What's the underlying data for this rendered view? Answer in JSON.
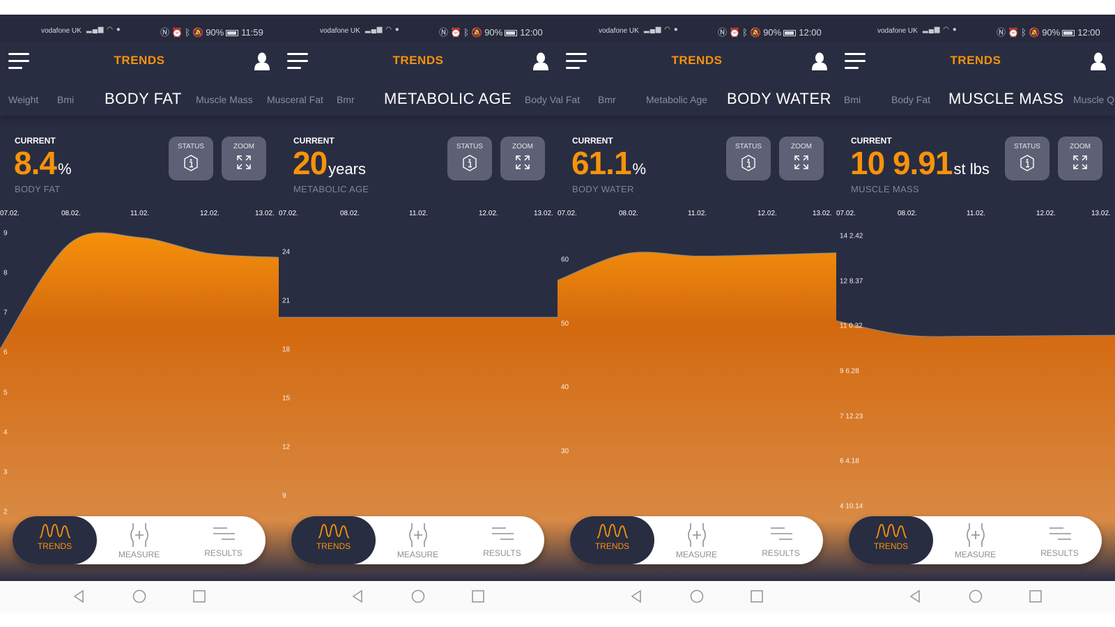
{
  "status_bar": [
    {
      "carrier": "vodafone UK",
      "battery": "90%",
      "time": "11:59"
    },
    {
      "carrier": "vodafone UK",
      "battery": "90%",
      "time": "12:00"
    },
    {
      "carrier": "vodafone UK",
      "battery": "90%",
      "time": "12:00"
    },
    {
      "carrier": "vodafone UK",
      "battery": "90%",
      "time": "12:00"
    }
  ],
  "header": {
    "title": "TRENDS"
  },
  "tab_strip": [
    {
      "label": "Weight"
    },
    {
      "label": "Bmi"
    },
    {
      "label": "BODY FAT",
      "active": true
    },
    {
      "label": "Muscle Mass"
    },
    {
      "label": "Musceral Fat"
    },
    {
      "label": "Bmr"
    },
    {
      "label": "METABOLIC AGE",
      "active": true
    },
    {
      "label": "Body Val Fat"
    },
    {
      "label": "Bmr"
    },
    {
      "label": "Metabolic Age"
    },
    {
      "label": "BODY WATER",
      "active": true
    },
    {
      "label": "Bmi"
    },
    {
      "label": "Body Fat"
    },
    {
      "label": "MUSCLE MASS",
      "active": true
    },
    {
      "label": "Muscle Q"
    }
  ],
  "current_label": "CURRENT",
  "buttons": {
    "status": "STATUS",
    "zoom": "ZOOM"
  },
  "bottom_nav": {
    "trends": "TRENDS",
    "measure": "MEASURE",
    "results": "RESULTS"
  },
  "colors": {
    "accent": "#f7930a",
    "background": "#292d41",
    "button": "#5e6175"
  },
  "panels": [
    {
      "value": "8.4",
      "unit": "%",
      "metric": "BODY FAT"
    },
    {
      "value": "20",
      "unit": "years",
      "metric": "METABOLIC AGE"
    },
    {
      "value": "61.1",
      "unit": "%",
      "metric": "BODY WATER"
    },
    {
      "value": "10 9.91",
      "unit": "st lbs",
      "metric": "MUSCLE MASS"
    }
  ],
  "chart_data": [
    {
      "type": "area",
      "categories": [
        "07.02.",
        "08.02.",
        "11.02.",
        "12.02.",
        "13.02."
      ],
      "values": [
        6.1,
        8.75,
        8.9,
        8.5,
        8.4
      ],
      "y_ticks": [
        "9",
        "8",
        "7",
        "6",
        "5",
        "4",
        "3",
        "2"
      ]
    },
    {
      "type": "area",
      "categories": [
        "07.02.",
        "08.02.",
        "11.02.",
        "12.02.",
        "13.02."
      ],
      "values": [
        20,
        20,
        20,
        20,
        20
      ],
      "y_ticks": [
        "24",
        "21",
        "18",
        "15",
        "12",
        "9"
      ]
    },
    {
      "type": "area",
      "categories": [
        "07.02.",
        "08.02.",
        "11.02.",
        "12.02.",
        "13.02."
      ],
      "values": [
        56.8,
        61.0,
        60.6,
        60.8,
        61.1
      ],
      "y_ticks": [
        "60",
        "50",
        "40",
        "30"
      ]
    },
    {
      "type": "area",
      "categories": [
        "07.02.",
        "08.02.",
        "11.02.",
        "12.02.",
        "13.02."
      ],
      "values": [
        "11 3.0",
        "10 10.0",
        "10 9.5",
        "10 9.7",
        "10 9.91"
      ],
      "y_ticks": [
        "14 2.42",
        "12 8.37",
        "11 0.32",
        "9 6.28",
        "7 12.23",
        "6 4.18",
        "4 10.14"
      ]
    }
  ]
}
